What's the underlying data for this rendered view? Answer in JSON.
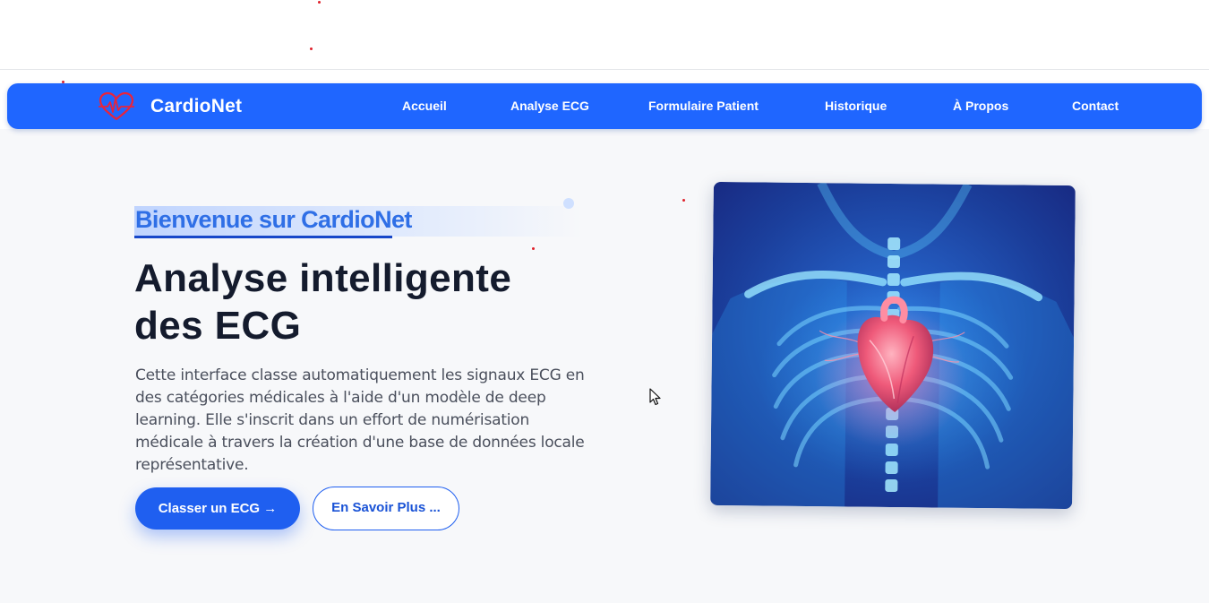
{
  "navbar": {
    "brand_name": "CardioNet",
    "links": [
      {
        "label": "Accueil"
      },
      {
        "label": "Analyse ECG"
      },
      {
        "label": "Formulaire Patient"
      },
      {
        "label": "Historique"
      },
      {
        "label": "À Propos"
      },
      {
        "label": "Contact"
      }
    ]
  },
  "hero": {
    "welcome": "Bienvenue sur CardioNet",
    "headline_line1": "Analyse intelligente",
    "headline_line2": "des ECG",
    "description": "Cette interface classe automatiquement les signaux ECG en des catégories médicales à l'aide d'un modèle de deep learning. Elle s'inscrit dans un effort de numérisation médicale à travers la création d'une base de données locale représentative.",
    "primary_button": "Classer un ECG →",
    "secondary_button": "En Savoir Plus ..."
  },
  "icons": {
    "brand_logo": "heart-ecg-icon",
    "cursor": "mouse-pointer-icon"
  },
  "colors": {
    "nav_background": "#1f66ff",
    "accent": "#1f5ff0",
    "welcome_text": "#2f6fe6",
    "headline": "#141b2d",
    "body_text": "#4a4f5c"
  }
}
